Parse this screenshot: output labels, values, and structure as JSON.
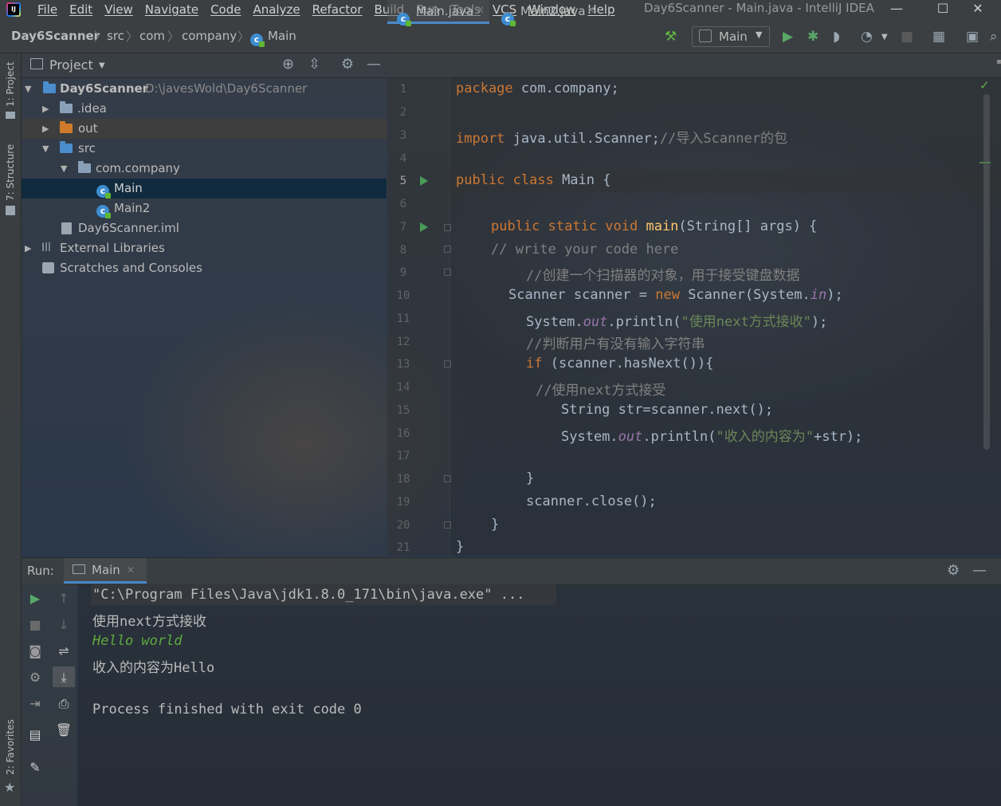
{
  "window": {
    "title": "Day6Scanner - Main.java - IntelliJ IDEA",
    "controls": [
      "—",
      "☐",
      "✕"
    ]
  },
  "menu": [
    "File",
    "Edit",
    "View",
    "Navigate",
    "Code",
    "Analyze",
    "Refactor",
    "Build",
    "Run",
    "Tools",
    "VCS",
    "Window",
    "Help"
  ],
  "breadcrumbs": [
    "Day6Scanner",
    "src",
    "com",
    "company",
    "Main"
  ],
  "run_config": "Main",
  "left_stripe": {
    "project": "1: Project",
    "structure": "7: Structure",
    "favorites": "2: Favorites"
  },
  "project_panel": {
    "title": "Project",
    "root_name": "Day6Scanner",
    "root_path": "D:\\javesWold\\Day6Scanner",
    "items": [
      {
        "label": ".idea"
      },
      {
        "label": "out"
      },
      {
        "label": "src"
      },
      {
        "label": "com.company"
      },
      {
        "label": "Main"
      },
      {
        "label": "Main2"
      },
      {
        "label": "Day6Scanner.iml"
      },
      {
        "label": "External Libraries"
      },
      {
        "label": "Scratches and Consoles"
      }
    ]
  },
  "editor": {
    "tabs": [
      {
        "label": "Main.java",
        "active": true
      },
      {
        "label": "Main2.java",
        "active": false
      }
    ],
    "line_numbers": [
      "1",
      "2",
      "3",
      "4",
      "5",
      "6",
      "7",
      "8",
      "9",
      "10",
      "11",
      "12",
      "13",
      "14",
      "15",
      "16",
      "17",
      "18",
      "19",
      "20",
      "21"
    ],
    "code": {
      "l1_kw": "package",
      "l1_rest": " com.company;",
      "l3_kw": "import",
      "l3_rest": " java.util.Scanner;",
      "l3_cm": "//导入Scanner的包",
      "l5_kw": "public class",
      "l5_rest": " Main {",
      "l7_kw": "public static void",
      "l7_fn": " main",
      "l7_rest": "(String[] args) {",
      "l8_cm": "// write your code here",
      "l9_cm": "//创建一个扫描器的对象，用于接受键盘数据",
      "l10_a": "Scanner scanner = ",
      "l10_kw": "new",
      "l10_b": " Scanner(System.",
      "l10_st": "in",
      "l10_c": ");",
      "l11_a": "System.",
      "l11_st": "out",
      "l11_b": ".println(",
      "l11_str": "\"使用next方式接收\"",
      "l11_c": ");",
      "l12_cm": "//判断用户有没有输入字符串",
      "l13_kw": "if",
      "l13_rest": " (scanner.hasNext()){",
      "l14_cm": "//使用next方式接受",
      "l15": "String str=scanner.next();",
      "l16_a": "System.",
      "l16_st": "out",
      "l16_b": ".println(",
      "l16_str": "\"收入的内容为\"",
      "l16_c": "+str);",
      "l18": "}",
      "l19": "scanner.close();",
      "l20": "}",
      "l21": "}"
    }
  },
  "run_panel": {
    "label": "Run:",
    "tab": "Main",
    "console": [
      "\"C:\\Program Files\\Java\\jdk1.8.0_171\\bin\\java.exe\" ...",
      "使用next方式接收",
      "Hello world",
      "收入的内容为Hello",
      "",
      "Process finished with exit code 0"
    ]
  },
  "colors": {
    "keyword": "#cc7832",
    "comment": "#808080",
    "string": "#6a8759",
    "static_field": "#9876aa",
    "method": "#ffc66d",
    "user_input": "#5faa3e",
    "selection": "#0d293e"
  }
}
